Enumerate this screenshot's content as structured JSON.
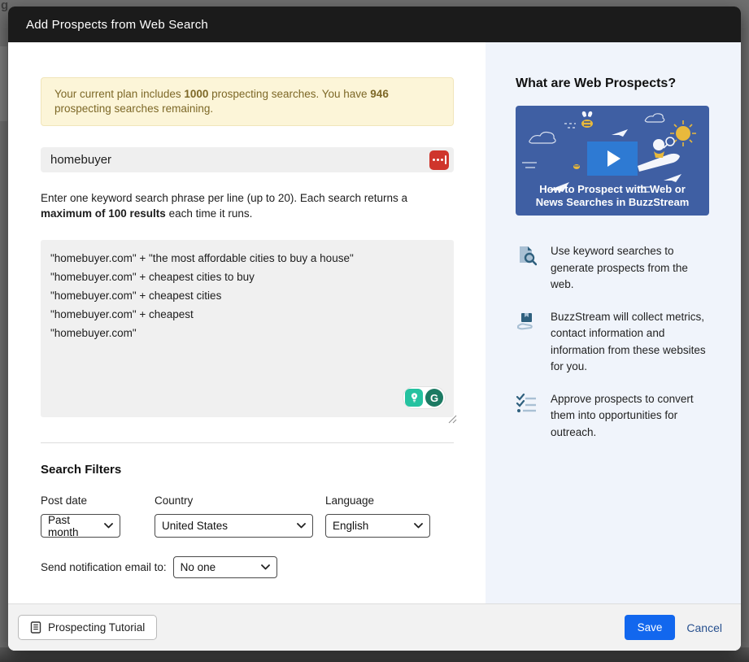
{
  "overlay": {
    "background_page_text": "g"
  },
  "modal": {
    "title": "Add Prospects from Web Search",
    "alert": {
      "part1": "Your current plan includes ",
      "plan_total": "1000",
      "part2": " prospecting searches. You have ",
      "remaining": "946",
      "part3": " prospecting searches remaining."
    },
    "domain_field": {
      "value": "homebuyer"
    },
    "instructions": {
      "part1": "Enter one keyword search phrase per line (up to 20). Each search returns a ",
      "bold": "maximum of 100 results",
      "part2": " each time it runs."
    },
    "keywords": {
      "lines": [
        "\"homebuyer.com\" + \"the most affordable cities to buy a house\"",
        "\"homebuyer.com\" + cheapest cities to buy",
        "\"homebuyer.com\" + cheapest cities",
        "\"homebuyer.com\" + cheapest",
        "\"homebuyer.com\""
      ]
    },
    "grammarly": {
      "g_letter": "G"
    },
    "filters": {
      "heading": "Search Filters",
      "post_date": {
        "label": "Post date",
        "value": "Past month"
      },
      "country": {
        "label": "Country",
        "value": "United States"
      },
      "language": {
        "label": "Language",
        "value": "English"
      },
      "notification": {
        "label": "Send notification email to:",
        "value": "No one"
      }
    },
    "sidebar": {
      "heading": "What are Web Prospects?",
      "video_caption": "How to Prospect with Web or News Searches in BuzzStream",
      "bullets": [
        {
          "icon": "document-search-icon",
          "text": "Use keyword searches to generate prospects from the web."
        },
        {
          "icon": "collect-metrics-icon",
          "text": "BuzzStream will collect metrics, contact information and information from these websites for you."
        },
        {
          "icon": "approve-checklist-icon",
          "text": "Approve prospects to convert them into opportunities for outreach."
        }
      ]
    },
    "footer": {
      "tutorial_label": "Prospecting Tutorial",
      "save_label": "Save",
      "cancel_label": "Cancel"
    }
  },
  "colors": {
    "header_bg": "#1b1b1b",
    "alert_bg": "#fcf5d8",
    "alert_text": "#7d6827",
    "save_blue": "#1267ee",
    "cancel_blue": "#28518f",
    "sidebar_bg": "#f0f4fb",
    "thumb_bg": "#3f5fa3",
    "play_bg": "#2e7ad3",
    "autofill_red": "#cf352c",
    "grammarly_teal": "#25c2a0",
    "grammarly_dark_green": "#1c7a63",
    "icon_light_slate": "#a9c0d4",
    "icon_dark_slate": "#2f607e"
  }
}
